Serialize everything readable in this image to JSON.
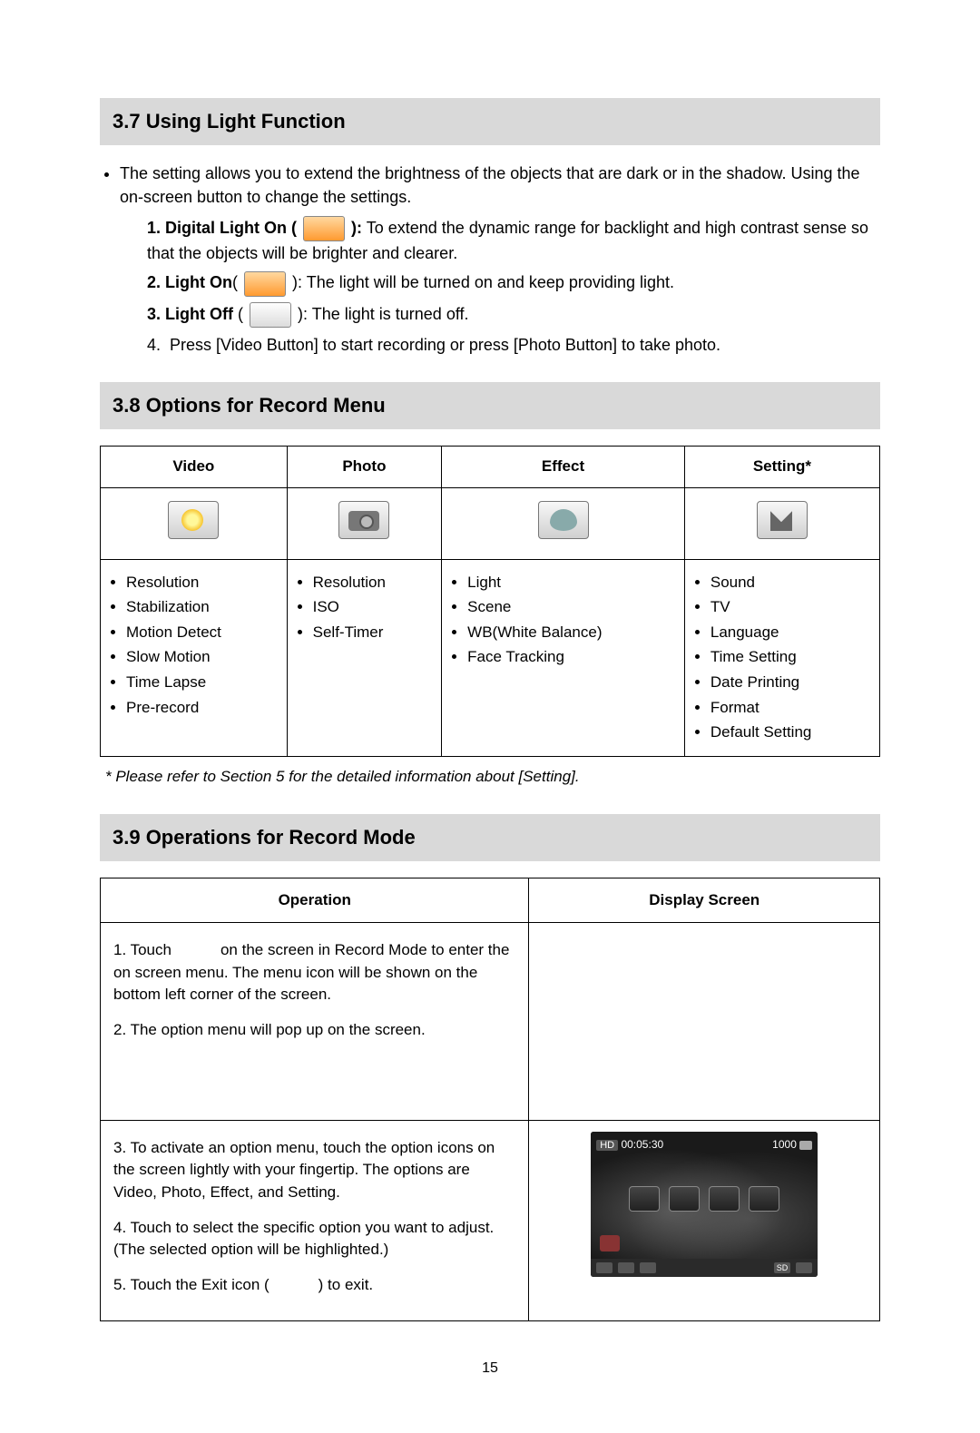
{
  "section37": {
    "title": "3.7 Using Light Function",
    "intro": "The setting allows you to extend the brightness of the objects that are dark or in the shadow. Using the on-screen button to change the settings.",
    "items": [
      {
        "num": "1.",
        "label": "Digital Light On (",
        "close": "):",
        "desc": " To extend the dynamic range for backlight and high contrast sense so that the objects will be brighter and clearer."
      },
      {
        "num": "2.",
        "label": "Light On",
        "open": "(",
        "close": "):",
        "desc": " The light will be turned on and keep providing light."
      },
      {
        "num": "3.",
        "label": "Light Off",
        "open": " (",
        "close": "):",
        "desc": " The light is turned off."
      },
      {
        "num": "4.",
        "plain": "Press [Video Button] to start recording or press [Photo Button]  to take photo."
      }
    ]
  },
  "section38": {
    "title": "3.8 Options for Record Menu",
    "headers": [
      "Video",
      "Photo",
      "Effect",
      "Setting*"
    ],
    "cols": [
      [
        "Resolution",
        "Stabilization",
        "Motion Detect",
        "Slow Motion",
        "Time Lapse",
        "Pre-record"
      ],
      [
        "Resolution",
        "ISO",
        "Self-Timer"
      ],
      [
        "Light",
        "Scene",
        "WB(White Balance)",
        "Face Tracking"
      ],
      [
        "Sound",
        "TV",
        "Language",
        "Time Setting",
        "Date Printing",
        "Format",
        "Default Setting"
      ]
    ],
    "note": "* Please refer to Section 5 for the detailed information about [Setting]."
  },
  "section39": {
    "title": "3.9 Operations for Record Mode",
    "headers": [
      "Operation",
      "Display Screen"
    ],
    "row1": {
      "step1a": "1. Touch",
      "step1b": "on the screen in Record Mode to enter the on screen menu. The menu icon will be shown on the bottom left corner of the screen.",
      "step2": "2. The option menu will pop up on the screen."
    },
    "row2": {
      "step3": "3. To activate an option menu, touch the option icons on the screen lightly with your fingertip. The options are Video, Photo, Effect, and Setting.",
      "step4": "4. Touch to select the specific option you want to adjust. (The selected option will be highlighted.)",
      "step5a": "5. Touch the Exit icon (",
      "step5b": ") to exit."
    },
    "screen": {
      "hd": "HD",
      "time": "00:05:30",
      "count": "1000",
      "sd": "SD"
    }
  },
  "page": "15"
}
